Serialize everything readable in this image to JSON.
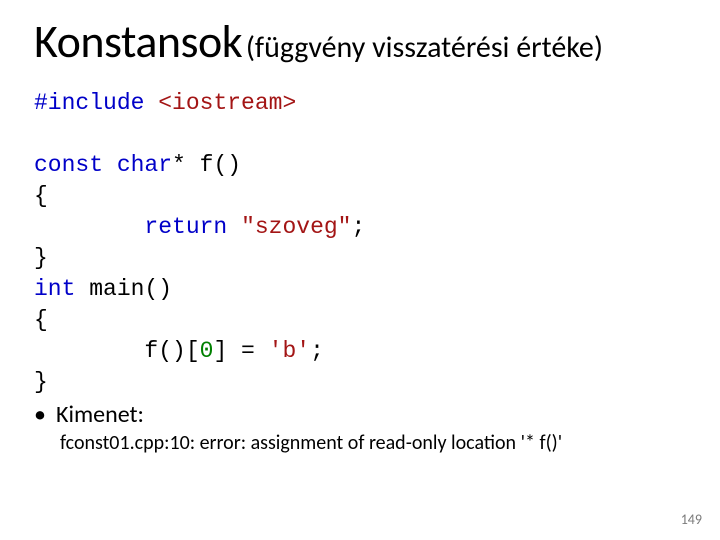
{
  "title": {
    "main": "Konstansok",
    "sub": "(függvény visszatérési értéke)"
  },
  "code": {
    "include_kw": "#include",
    "include_hdr": "<iostream>",
    "l1_const": "const",
    "l1_char": "char",
    "l1_rest": "* f()",
    "brace_open": "{",
    "ret_kw": "return",
    "ret_str": "\"szoveg\"",
    "semicolon": ";",
    "brace_close": "}",
    "int_kw": "int",
    "main_sig": " main()",
    "call_part1": "f()[",
    "zero": "0",
    "call_part2": "] = ",
    "char_b": "'b'"
  },
  "bullet_label": "Kimenet:",
  "error_line": "fconst01.cpp:10: error: assignment of read-only location '* f()'",
  "page_number": "149"
}
